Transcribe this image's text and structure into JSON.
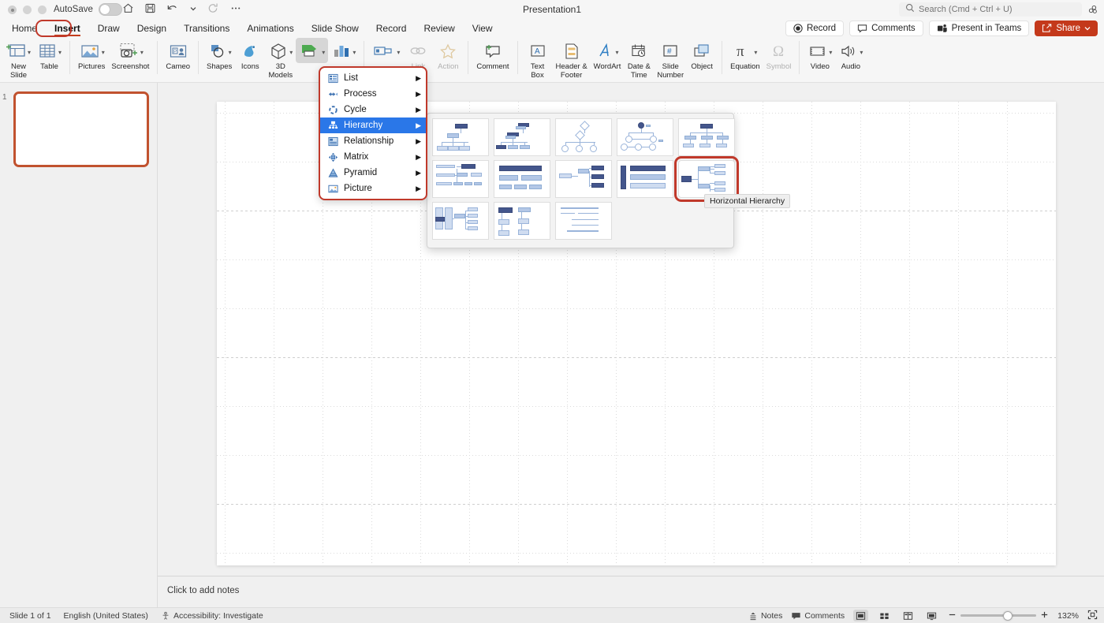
{
  "titlebar": {
    "autosave_label": "AutoSave",
    "document_title": "Presentation1",
    "quick_access": [
      {
        "name": "home-icon",
        "label": "Home"
      },
      {
        "name": "save-icon",
        "label": "Save"
      },
      {
        "name": "undo-icon",
        "label": "Undo"
      },
      {
        "name": "redo-icon",
        "label": "Redo"
      },
      {
        "name": "more-icon",
        "label": "More"
      }
    ]
  },
  "search": {
    "placeholder": "Search (Cmd + Ctrl + U)",
    "icon": "search-icon"
  },
  "tabs": [
    {
      "label": "Home",
      "active": false
    },
    {
      "label": "Insert",
      "active": true
    },
    {
      "label": "Draw",
      "active": false
    },
    {
      "label": "Design",
      "active": false
    },
    {
      "label": "Transitions",
      "active": false
    },
    {
      "label": "Animations",
      "active": false
    },
    {
      "label": "Slide Show",
      "active": false
    },
    {
      "label": "Record",
      "active": false
    },
    {
      "label": "Review",
      "active": false
    },
    {
      "label": "View",
      "active": false
    }
  ],
  "tabbar_actions": [
    {
      "label": "Record",
      "icon": "record-icon"
    },
    {
      "label": "Comments",
      "icon": "comment-icon"
    },
    {
      "label": "Present in Teams",
      "icon": "teams-icon"
    },
    {
      "label": "Share",
      "icon": "share-icon",
      "accent": "#c4391b"
    }
  ],
  "ribbon": {
    "groups": [
      {
        "items": [
          {
            "label": "New\nSlide",
            "icon": "new-slide-icon",
            "caret": true,
            "dim": false,
            "pressed": false
          },
          {
            "label": "Table",
            "icon": "table-icon",
            "caret": true,
            "dim": false,
            "pressed": false
          }
        ]
      },
      {
        "items": [
          {
            "label": "Pictures",
            "icon": "pictures-icon",
            "caret": true,
            "dim": false,
            "pressed": false
          },
          {
            "label": "Screenshot",
            "icon": "screenshot-icon",
            "caret": true,
            "dim": false,
            "pressed": false
          }
        ]
      },
      {
        "items": [
          {
            "label": "Cameo",
            "icon": "cameo-icon",
            "caret": false,
            "dim": false,
            "pressed": false
          }
        ]
      },
      {
        "items": [
          {
            "label": "Shapes",
            "icon": "shapes-icon",
            "caret": true,
            "dim": false,
            "pressed": false
          },
          {
            "label": "Icons",
            "icon": "icons-icon",
            "caret": false,
            "dim": false,
            "pressed": false
          },
          {
            "label": "3D\nModels",
            "icon": "3d-models-icon",
            "caret": true,
            "dim": false,
            "pressed": false
          },
          {
            "label": "",
            "icon": "smartart-icon",
            "caret": true,
            "dim": false,
            "pressed": true
          },
          {
            "label": "",
            "icon": "chart-icon",
            "caret": true,
            "dim": false,
            "pressed": false
          }
        ]
      },
      {
        "items": [
          {
            "label": "",
            "icon": "media-icon",
            "caret": true,
            "dim": false,
            "pressed": false
          },
          {
            "label": "Link",
            "icon": "link-icon",
            "caret": false,
            "dim": true,
            "pressed": false
          },
          {
            "label": "Action",
            "icon": "action-icon",
            "caret": false,
            "dim": true,
            "pressed": false
          }
        ]
      },
      {
        "items": [
          {
            "label": "Comment",
            "icon": "comment-add-icon",
            "caret": false,
            "dim": false,
            "pressed": false
          }
        ]
      },
      {
        "items": [
          {
            "label": "Text\nBox",
            "icon": "text-box-icon",
            "caret": false,
            "dim": false,
            "pressed": false
          },
          {
            "label": "Header &\nFooter",
            "icon": "header-footer-icon",
            "caret": false,
            "dim": false,
            "pressed": false
          },
          {
            "label": "WordArt",
            "icon": "wordart-icon",
            "caret": true,
            "dim": false,
            "pressed": false
          },
          {
            "label": "Date &\nTime",
            "icon": "date-time-icon",
            "caret": false,
            "dim": false,
            "pressed": false
          },
          {
            "label": "Slide\nNumber",
            "icon": "slide-number-icon",
            "caret": false,
            "dim": false,
            "pressed": false
          },
          {
            "label": "Object",
            "icon": "object-icon",
            "caret": false,
            "dim": false,
            "pressed": false
          }
        ]
      },
      {
        "items": [
          {
            "label": "Equation",
            "icon": "equation-icon",
            "caret": true,
            "dim": false,
            "pressed": false
          },
          {
            "label": "Symbol",
            "icon": "symbol-icon",
            "caret": false,
            "dim": true,
            "pressed": false
          }
        ]
      },
      {
        "items": [
          {
            "label": "Video",
            "icon": "video-icon",
            "caret": true,
            "dim": false,
            "pressed": false
          },
          {
            "label": "Audio",
            "icon": "audio-icon",
            "caret": true,
            "dim": false,
            "pressed": false
          }
        ]
      }
    ]
  },
  "smartart_menu": {
    "items": [
      {
        "label": "List",
        "icon": "list-icon",
        "selected": false,
        "arrow": "▶"
      },
      {
        "label": "Process",
        "icon": "process-icon",
        "selected": false,
        "arrow": "▶"
      },
      {
        "label": "Cycle",
        "icon": "cycle-icon",
        "selected": false,
        "arrow": "▶"
      },
      {
        "label": "Hierarchy",
        "icon": "hierarchy-icon",
        "selected": true,
        "arrow": "▶"
      },
      {
        "label": "Relationship",
        "icon": "relationship-icon",
        "selected": false,
        "arrow": "▶"
      },
      {
        "label": "Matrix",
        "icon": "matrix-icon",
        "selected": false,
        "arrow": "▶"
      },
      {
        "label": "Pyramid",
        "icon": "pyramid-icon",
        "selected": false,
        "arrow": "▶"
      },
      {
        "label": "Picture",
        "icon": "picture-icon",
        "selected": false,
        "arrow": "▶"
      }
    ]
  },
  "gallery": {
    "tooltip": "Horizontal Hierarchy",
    "selected_index": 9,
    "items": [
      {
        "name": "organization-chart"
      },
      {
        "name": "name-and-title-organization-chart"
      },
      {
        "name": "half-circle-organization-chart"
      },
      {
        "name": "circle-picture-hierarchy"
      },
      {
        "name": "hierarchy"
      },
      {
        "name": "labeled-hierarchy"
      },
      {
        "name": "table-hierarchy"
      },
      {
        "name": "architecture-layout"
      },
      {
        "name": "horizontal-organization-chart"
      },
      {
        "name": "horizontal-hierarchy"
      },
      {
        "name": "horizontal-labeled-hierarchy"
      },
      {
        "name": "horizontal-multi-level-hierarchy"
      },
      {
        "name": "lined-list"
      }
    ]
  },
  "thumbnail_panel": {
    "slide_number": "1"
  },
  "notes": {
    "placeholder": "Click to add notes"
  },
  "statusbar": {
    "slide_count": "Slide 1 of 1",
    "language": "English (United States)",
    "accessibility": "Accessibility: Investigate",
    "notes_label": "Notes",
    "comments_label": "Comments",
    "zoom_level": "132%",
    "views": [
      {
        "name": "normal-view",
        "active": true
      },
      {
        "name": "slide-sorter-view",
        "active": false
      },
      {
        "name": "reading-view",
        "active": false
      },
      {
        "name": "presenter-view",
        "active": false
      }
    ]
  },
  "colors": {
    "accent": "#c4391b",
    "selection_blue": "#2a77e8",
    "highlight_red": "#c0392b",
    "node_dark": "#44568c",
    "node_light": "#cfdcf0"
  }
}
